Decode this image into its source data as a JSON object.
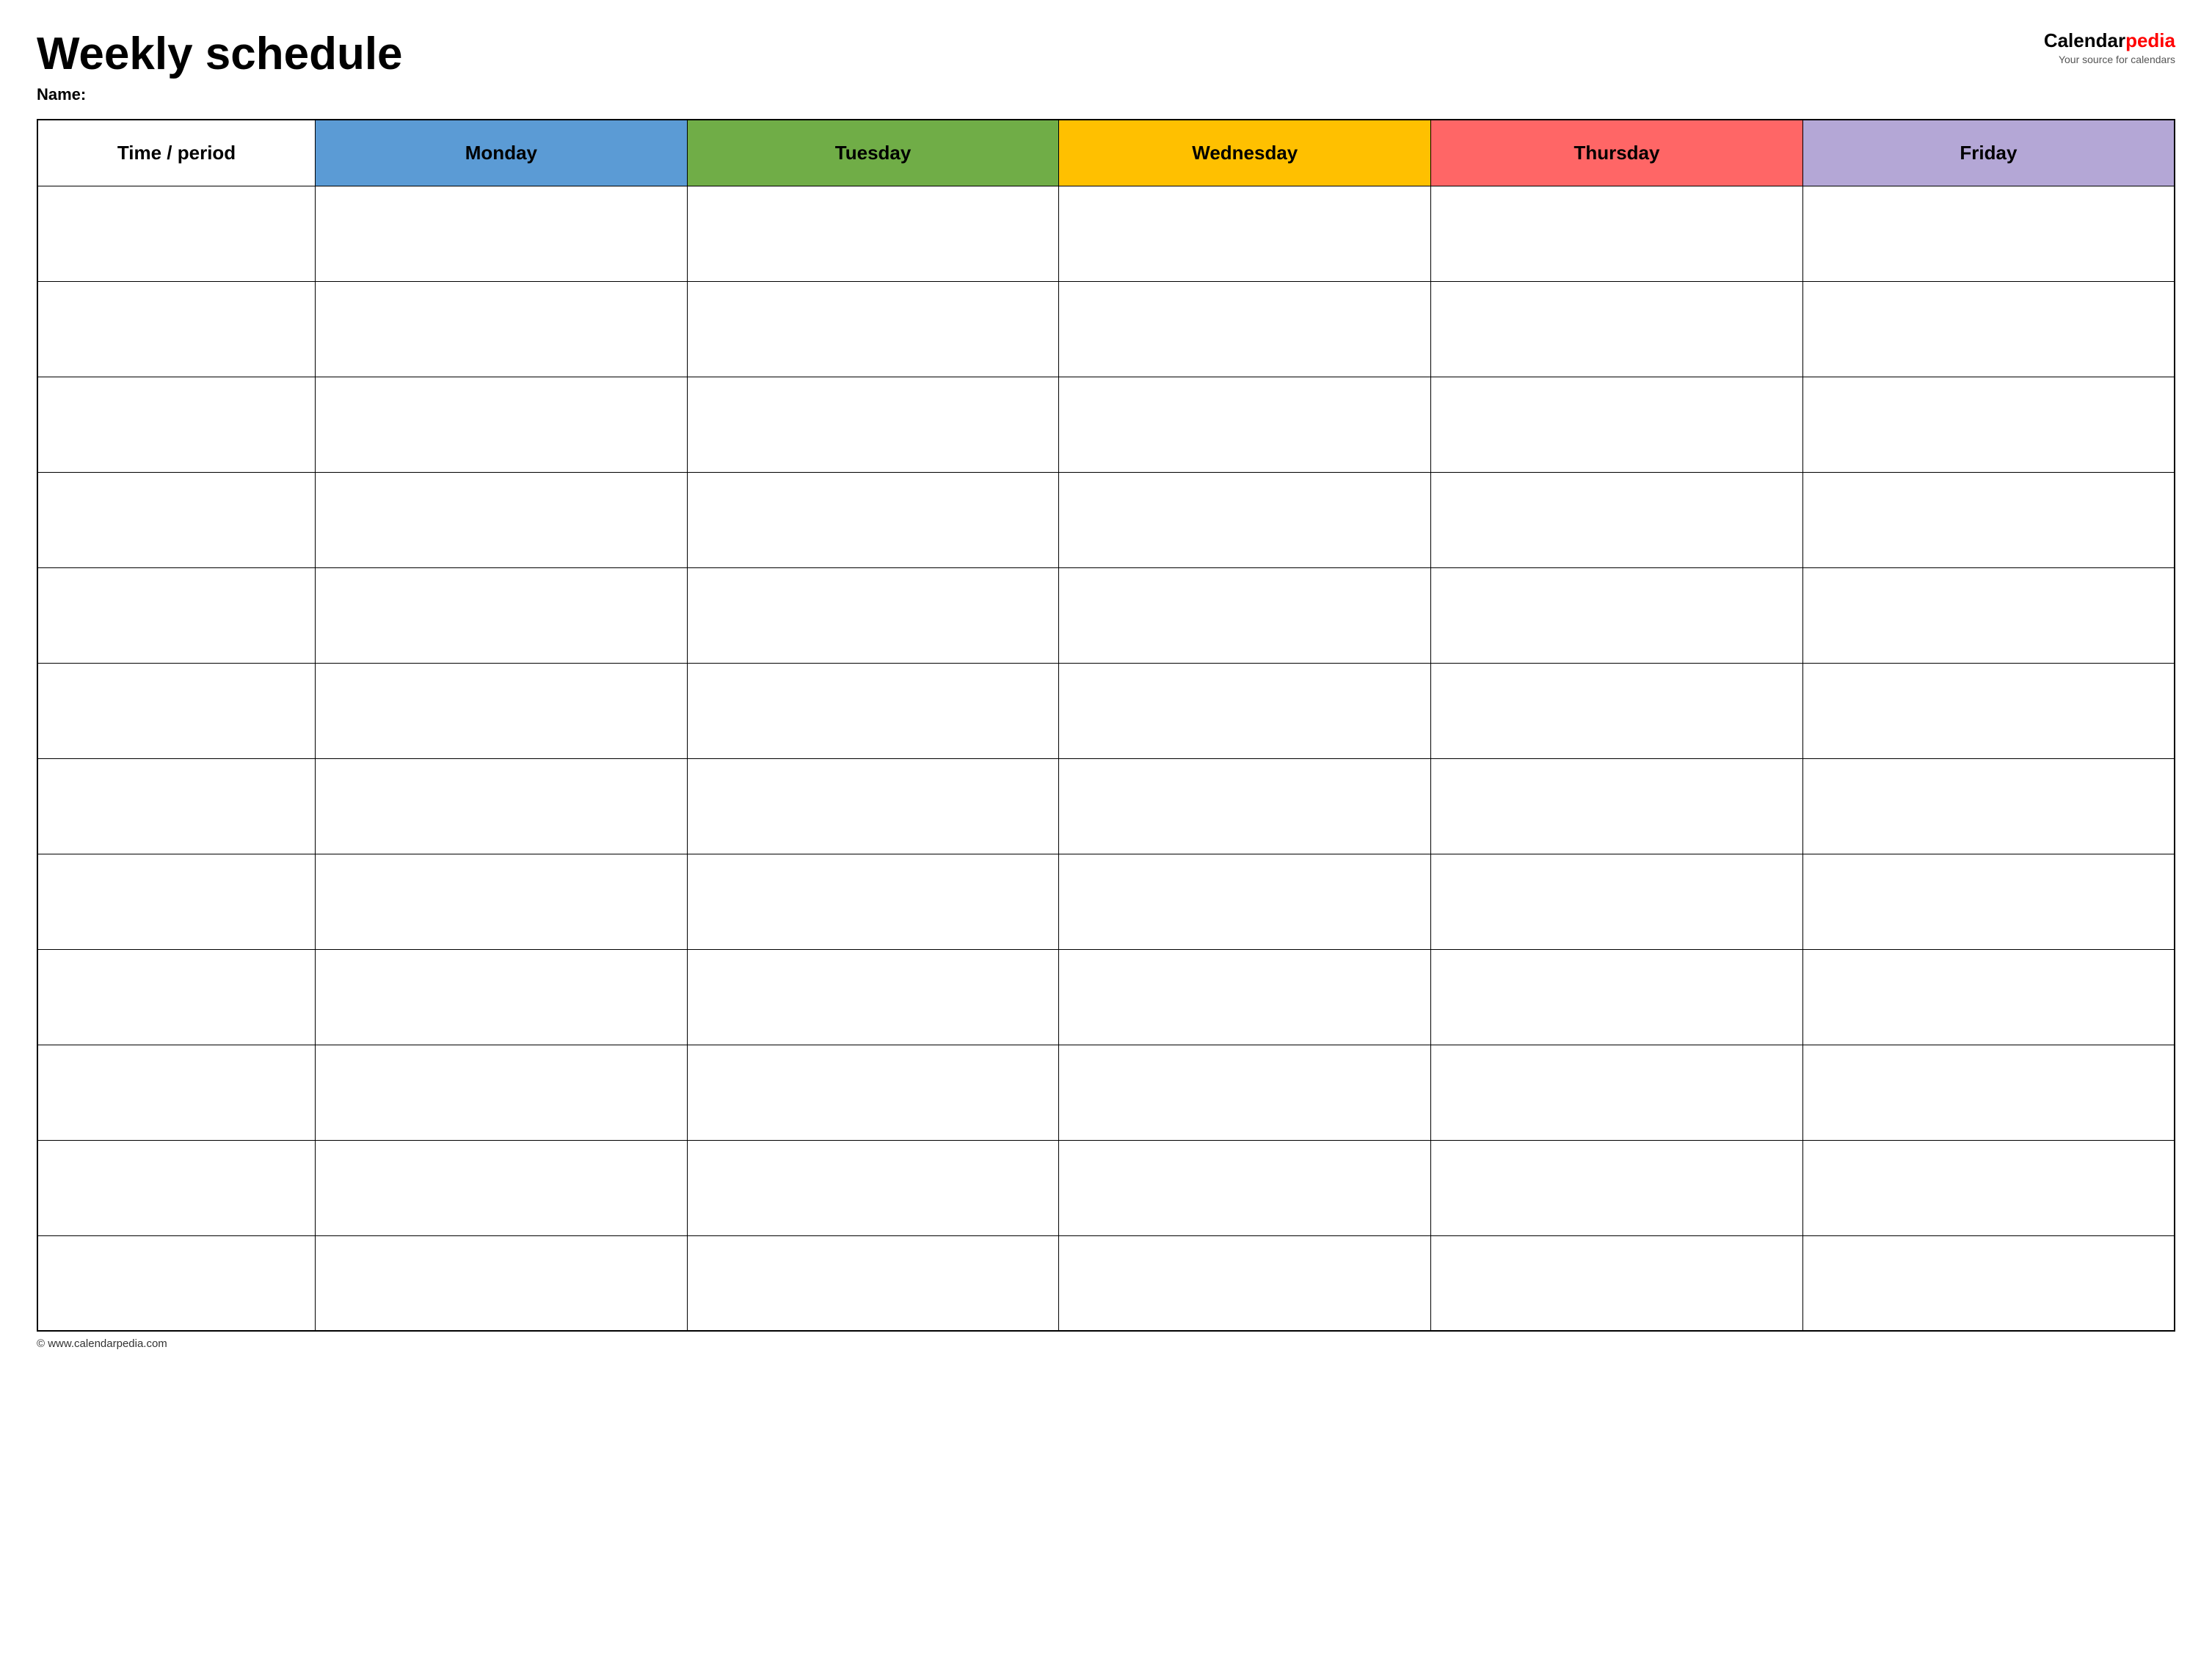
{
  "header": {
    "title": "Weekly schedule",
    "name_label": "Name:",
    "logo": {
      "calendar_text": "Calendar",
      "pedia_text": "pedia",
      "subtitle": "Your source for calendars"
    }
  },
  "table": {
    "columns": [
      {
        "key": "time",
        "label": "Time / period",
        "color": "#ffffff"
      },
      {
        "key": "monday",
        "label": "Monday",
        "color": "#5b9bd5"
      },
      {
        "key": "tuesday",
        "label": "Tuesday",
        "color": "#70ad47"
      },
      {
        "key": "wednesday",
        "label": "Wednesday",
        "color": "#ffc000"
      },
      {
        "key": "thursday",
        "label": "Thursday",
        "color": "#ff6666"
      },
      {
        "key": "friday",
        "label": "Friday",
        "color": "#b4a7d6"
      }
    ],
    "row_count": 12
  },
  "footer": {
    "url": "© www.calendarpedia.com"
  }
}
